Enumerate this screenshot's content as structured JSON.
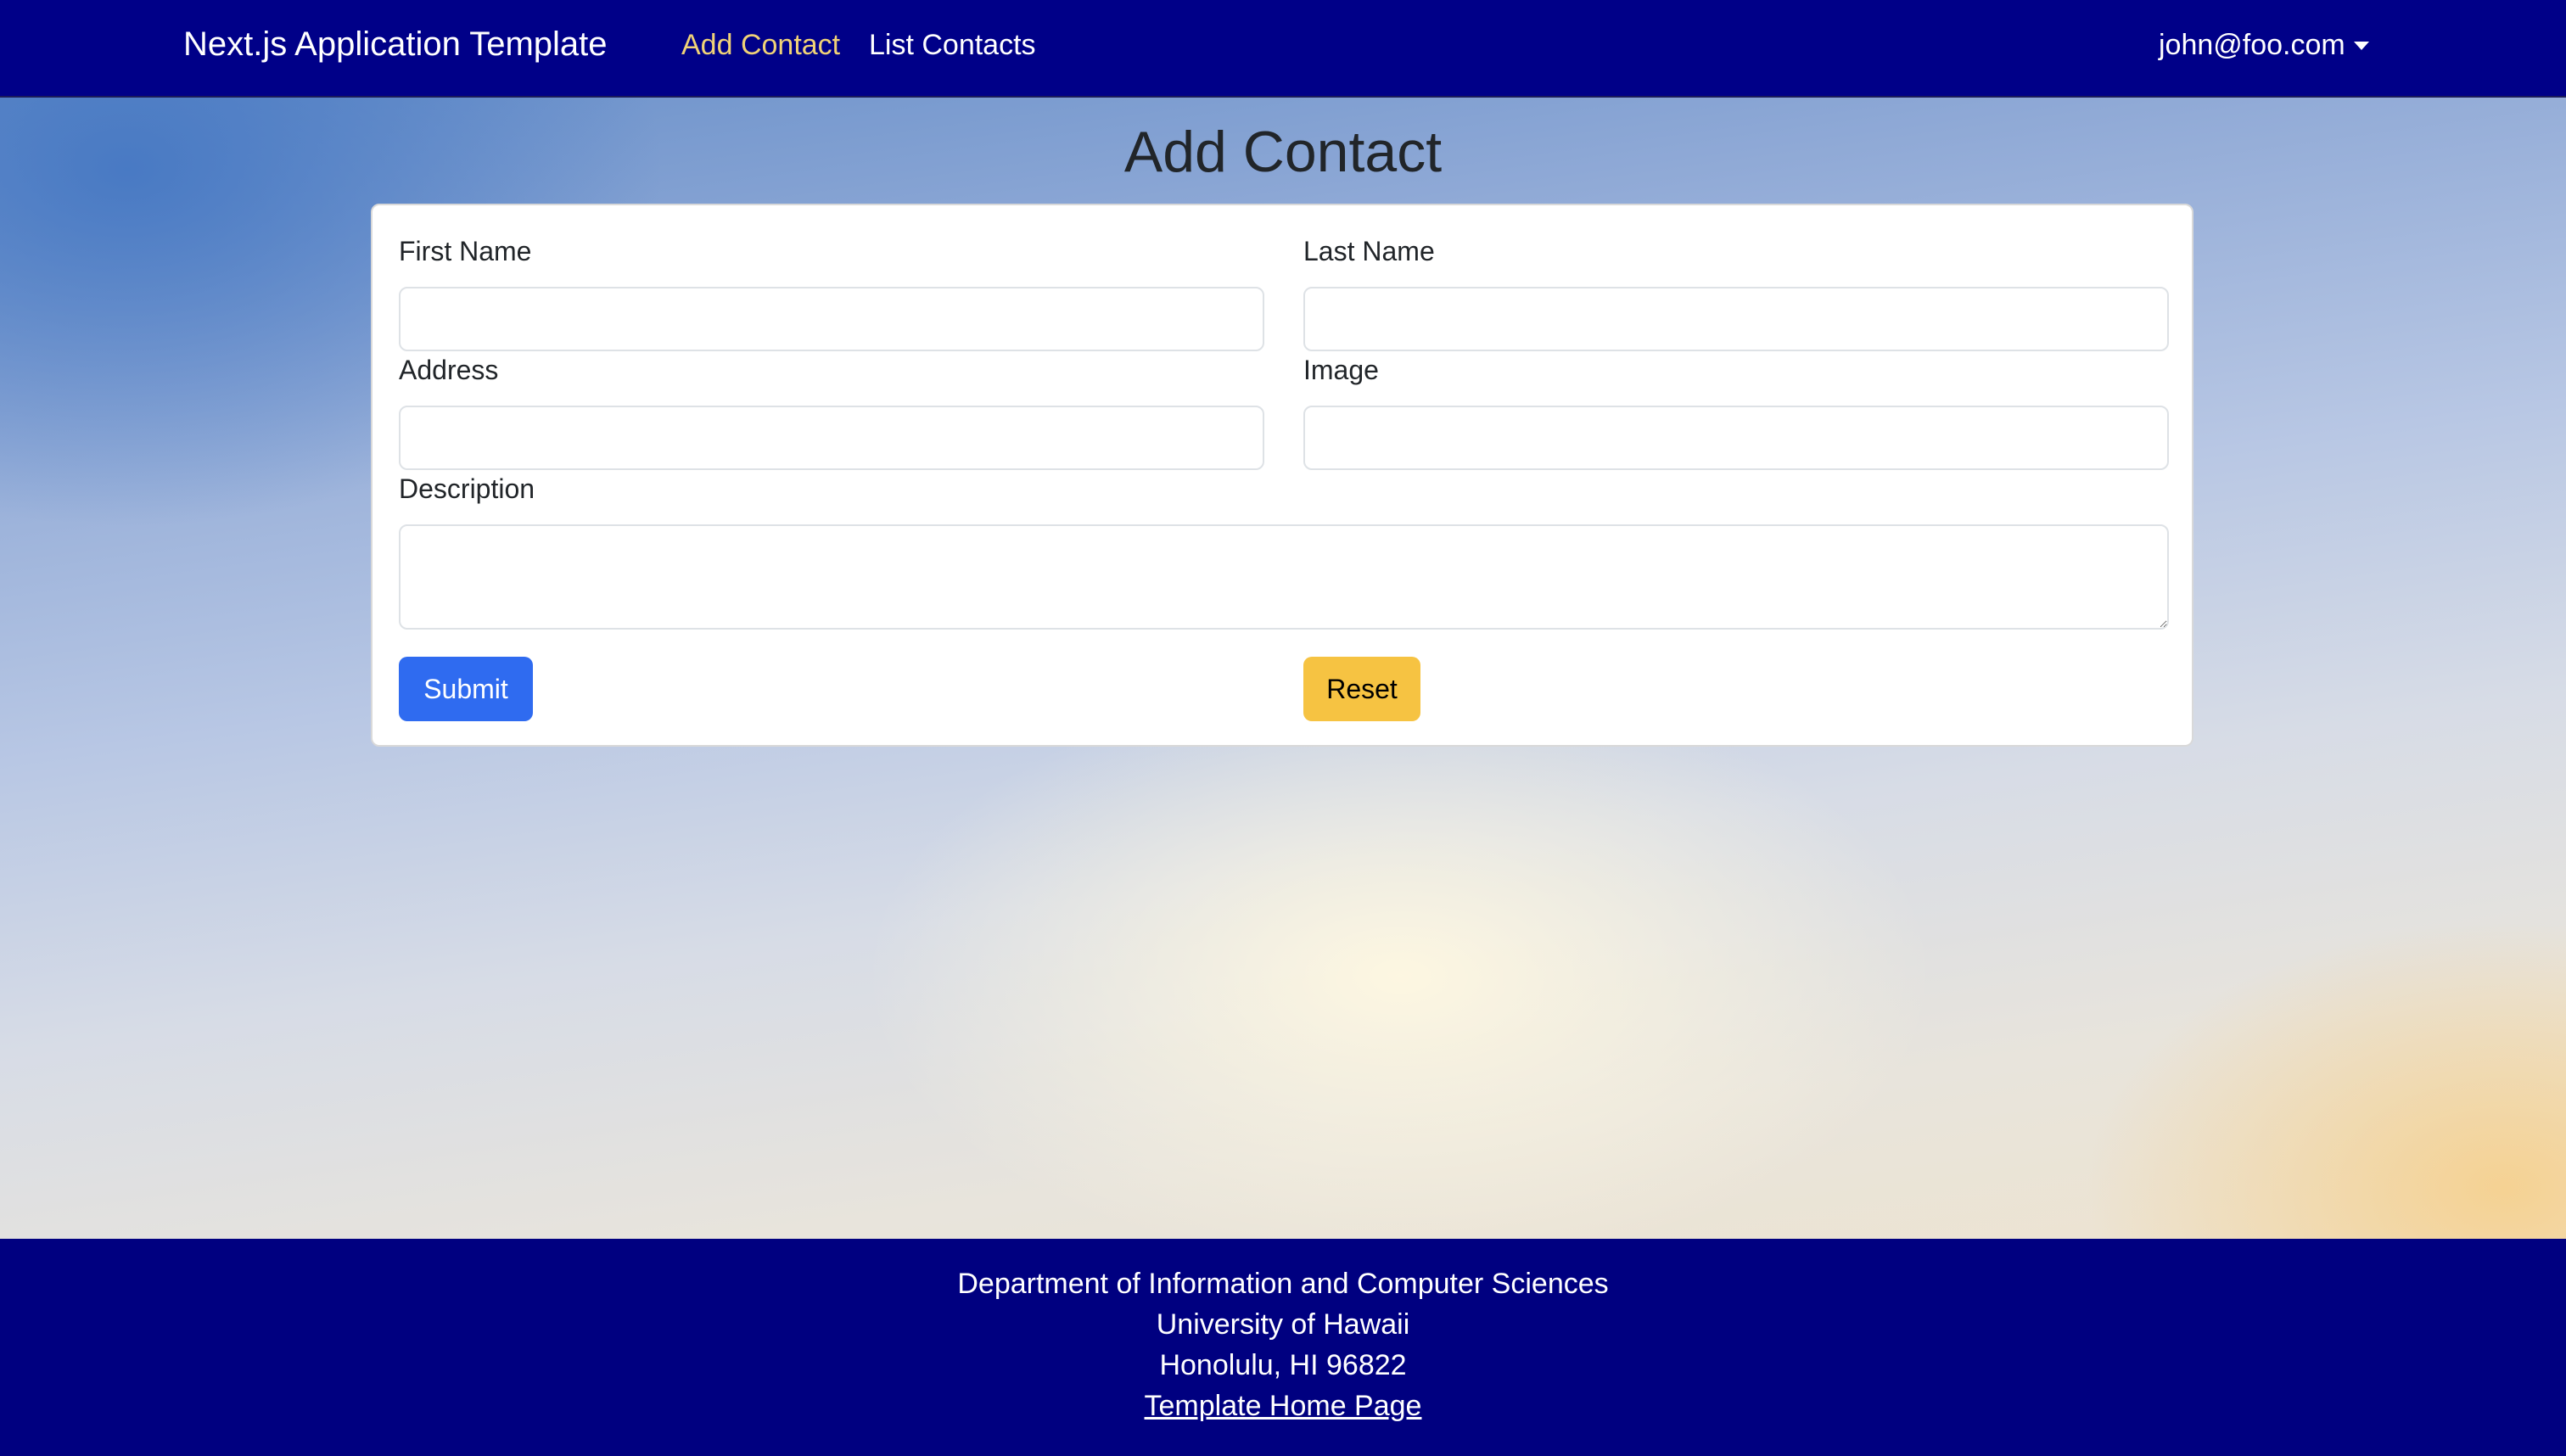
{
  "navbar": {
    "brand": "Next.js Application Template",
    "links": [
      {
        "label": "Add Contact",
        "active": true
      },
      {
        "label": "List Contacts",
        "active": false
      }
    ],
    "user": "john@foo.com",
    "background_color": "#000088",
    "active_link_color": "#f0d277"
  },
  "page": {
    "title": "Add Contact"
  },
  "form": {
    "first_name_label": "First Name",
    "first_name_value": "",
    "last_name_label": "Last Name",
    "last_name_value": "",
    "address_label": "Address",
    "address_value": "",
    "image_label": "Image",
    "image_value": "",
    "description_label": "Description",
    "description_value": "",
    "submit_label": "Submit",
    "reset_label": "Reset",
    "submit_color": "#2f6bf0",
    "reset_color": "#f6c342"
  },
  "footer": {
    "line1": "Department of Information and Computer Sciences",
    "line2": "University of Hawaii",
    "line3": "Honolulu, HI 96822",
    "link_label": "Template Home Page",
    "background_color": "#000080"
  },
  "icons": {
    "user_menu_dropdown": "caret-down-icon"
  }
}
